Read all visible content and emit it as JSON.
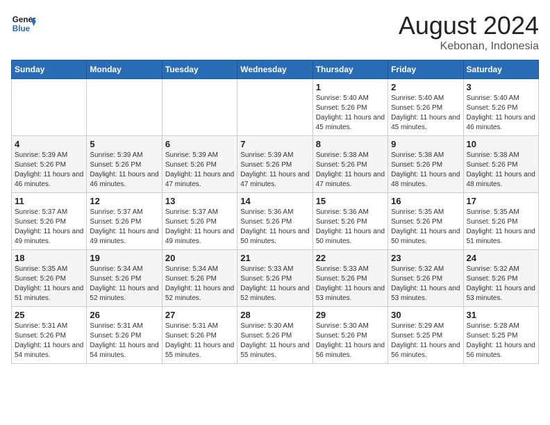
{
  "header": {
    "logo_line1": "General",
    "logo_line2": "Blue",
    "main_title": "August 2024",
    "subtitle": "Kebonan, Indonesia"
  },
  "weekdays": [
    "Sunday",
    "Monday",
    "Tuesday",
    "Wednesday",
    "Thursday",
    "Friday",
    "Saturday"
  ],
  "weeks": [
    [
      {
        "day": "",
        "sunrise": "",
        "sunset": "",
        "daylight": ""
      },
      {
        "day": "",
        "sunrise": "",
        "sunset": "",
        "daylight": ""
      },
      {
        "day": "",
        "sunrise": "",
        "sunset": "",
        "daylight": ""
      },
      {
        "day": "",
        "sunrise": "",
        "sunset": "",
        "daylight": ""
      },
      {
        "day": "1",
        "sunrise": "Sunrise: 5:40 AM",
        "sunset": "Sunset: 5:26 PM",
        "daylight": "Daylight: 11 hours and 45 minutes."
      },
      {
        "day": "2",
        "sunrise": "Sunrise: 5:40 AM",
        "sunset": "Sunset: 5:26 PM",
        "daylight": "Daylight: 11 hours and 45 minutes."
      },
      {
        "day": "3",
        "sunrise": "Sunrise: 5:40 AM",
        "sunset": "Sunset: 5:26 PM",
        "daylight": "Daylight: 11 hours and 46 minutes."
      }
    ],
    [
      {
        "day": "4",
        "sunrise": "Sunrise: 5:39 AM",
        "sunset": "Sunset: 5:26 PM",
        "daylight": "Daylight: 11 hours and 46 minutes."
      },
      {
        "day": "5",
        "sunrise": "Sunrise: 5:39 AM",
        "sunset": "Sunset: 5:26 PM",
        "daylight": "Daylight: 11 hours and 46 minutes."
      },
      {
        "day": "6",
        "sunrise": "Sunrise: 5:39 AM",
        "sunset": "Sunset: 5:26 PM",
        "daylight": "Daylight: 11 hours and 47 minutes."
      },
      {
        "day": "7",
        "sunrise": "Sunrise: 5:39 AM",
        "sunset": "Sunset: 5:26 PM",
        "daylight": "Daylight: 11 hours and 47 minutes."
      },
      {
        "day": "8",
        "sunrise": "Sunrise: 5:38 AM",
        "sunset": "Sunset: 5:26 PM",
        "daylight": "Daylight: 11 hours and 47 minutes."
      },
      {
        "day": "9",
        "sunrise": "Sunrise: 5:38 AM",
        "sunset": "Sunset: 5:26 PM",
        "daylight": "Daylight: 11 hours and 48 minutes."
      },
      {
        "day": "10",
        "sunrise": "Sunrise: 5:38 AM",
        "sunset": "Sunset: 5:26 PM",
        "daylight": "Daylight: 11 hours and 48 minutes."
      }
    ],
    [
      {
        "day": "11",
        "sunrise": "Sunrise: 5:37 AM",
        "sunset": "Sunset: 5:26 PM",
        "daylight": "Daylight: 11 hours and 49 minutes."
      },
      {
        "day": "12",
        "sunrise": "Sunrise: 5:37 AM",
        "sunset": "Sunset: 5:26 PM",
        "daylight": "Daylight: 11 hours and 49 minutes."
      },
      {
        "day": "13",
        "sunrise": "Sunrise: 5:37 AM",
        "sunset": "Sunset: 5:26 PM",
        "daylight": "Daylight: 11 hours and 49 minutes."
      },
      {
        "day": "14",
        "sunrise": "Sunrise: 5:36 AM",
        "sunset": "Sunset: 5:26 PM",
        "daylight": "Daylight: 11 hours and 50 minutes."
      },
      {
        "day": "15",
        "sunrise": "Sunrise: 5:36 AM",
        "sunset": "Sunset: 5:26 PM",
        "daylight": "Daylight: 11 hours and 50 minutes."
      },
      {
        "day": "16",
        "sunrise": "Sunrise: 5:35 AM",
        "sunset": "Sunset: 5:26 PM",
        "daylight": "Daylight: 11 hours and 50 minutes."
      },
      {
        "day": "17",
        "sunrise": "Sunrise: 5:35 AM",
        "sunset": "Sunset: 5:26 PM",
        "daylight": "Daylight: 11 hours and 51 minutes."
      }
    ],
    [
      {
        "day": "18",
        "sunrise": "Sunrise: 5:35 AM",
        "sunset": "Sunset: 5:26 PM",
        "daylight": "Daylight: 11 hours and 51 minutes."
      },
      {
        "day": "19",
        "sunrise": "Sunrise: 5:34 AM",
        "sunset": "Sunset: 5:26 PM",
        "daylight": "Daylight: 11 hours and 52 minutes."
      },
      {
        "day": "20",
        "sunrise": "Sunrise: 5:34 AM",
        "sunset": "Sunset: 5:26 PM",
        "daylight": "Daylight: 11 hours and 52 minutes."
      },
      {
        "day": "21",
        "sunrise": "Sunrise: 5:33 AM",
        "sunset": "Sunset: 5:26 PM",
        "daylight": "Daylight: 11 hours and 52 minutes."
      },
      {
        "day": "22",
        "sunrise": "Sunrise: 5:33 AM",
        "sunset": "Sunset: 5:26 PM",
        "daylight": "Daylight: 11 hours and 53 minutes."
      },
      {
        "day": "23",
        "sunrise": "Sunrise: 5:32 AM",
        "sunset": "Sunset: 5:26 PM",
        "daylight": "Daylight: 11 hours and 53 minutes."
      },
      {
        "day": "24",
        "sunrise": "Sunrise: 5:32 AM",
        "sunset": "Sunset: 5:26 PM",
        "daylight": "Daylight: 11 hours and 53 minutes."
      }
    ],
    [
      {
        "day": "25",
        "sunrise": "Sunrise: 5:31 AM",
        "sunset": "Sunset: 5:26 PM",
        "daylight": "Daylight: 11 hours and 54 minutes."
      },
      {
        "day": "26",
        "sunrise": "Sunrise: 5:31 AM",
        "sunset": "Sunset: 5:26 PM",
        "daylight": "Daylight: 11 hours and 54 minutes."
      },
      {
        "day": "27",
        "sunrise": "Sunrise: 5:31 AM",
        "sunset": "Sunset: 5:26 PM",
        "daylight": "Daylight: 11 hours and 55 minutes."
      },
      {
        "day": "28",
        "sunrise": "Sunrise: 5:30 AM",
        "sunset": "Sunset: 5:26 PM",
        "daylight": "Daylight: 11 hours and 55 minutes."
      },
      {
        "day": "29",
        "sunrise": "Sunrise: 5:30 AM",
        "sunset": "Sunset: 5:26 PM",
        "daylight": "Daylight: 11 hours and 56 minutes."
      },
      {
        "day": "30",
        "sunrise": "Sunrise: 5:29 AM",
        "sunset": "Sunset: 5:25 PM",
        "daylight": "Daylight: 11 hours and 56 minutes."
      },
      {
        "day": "31",
        "sunrise": "Sunrise: 5:28 AM",
        "sunset": "Sunset: 5:25 PM",
        "daylight": "Daylight: 11 hours and 56 minutes."
      }
    ]
  ]
}
